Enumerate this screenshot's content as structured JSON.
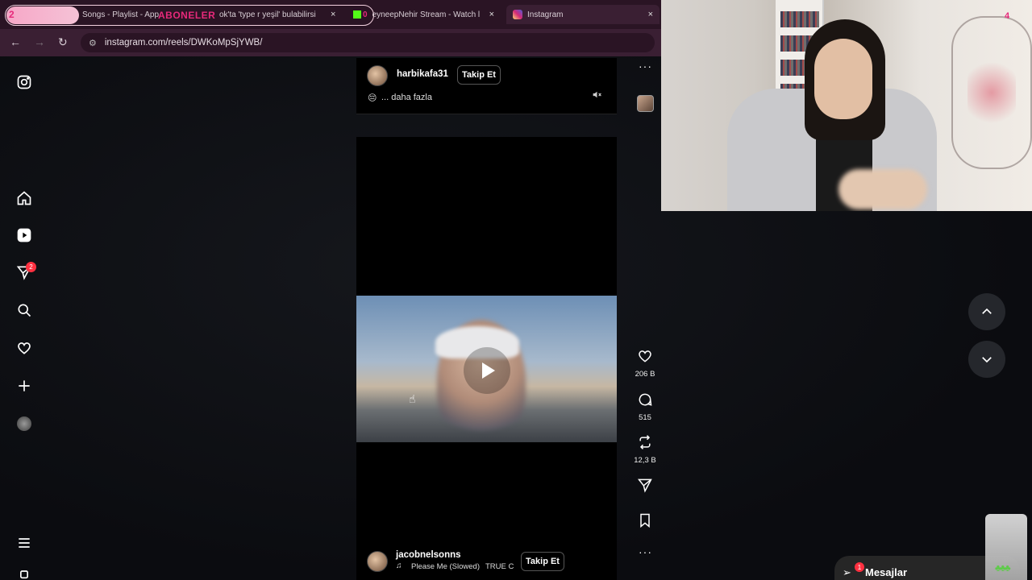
{
  "browser": {
    "overlay": {
      "counter": "2",
      "label": "ABONELER"
    },
    "tabs": [
      {
        "title": "Songs - Playlist - App",
        "close": "×"
      },
      {
        "title": "ok'ta 'type r yeşil' bulabilirsi",
        "close": "×"
      },
      {
        "title": "eyneepNehir Stream - Watch l",
        "prefix": "0",
        "close": "×"
      },
      {
        "title": "Instagram",
        "close": "×"
      }
    ],
    "url": "instagram.com/reels/DWKoMpSjYWB/"
  },
  "post_top": {
    "username": "harbikafa31",
    "follow_label": "Takip Et",
    "caption_emoji": "😔",
    "caption_more": "... daha fazla"
  },
  "post_bottom": {
    "username": "jacobnelsonns",
    "follow_label": "Takip Et",
    "music": "Please Me (Slowed)",
    "music_artist": "TRUE C"
  },
  "actions": {
    "likes": "206 B",
    "comments": "515",
    "reposts": "12,3 B"
  },
  "sidebar": {
    "messages_badge": "2"
  },
  "messages": {
    "label": "Mesajlar",
    "badge": "1"
  },
  "webcam": {
    "corner_num": "4"
  },
  "icons": [
    "instagram-icon",
    "home-icon",
    "reels-icon",
    "direct-icon",
    "search-icon",
    "heart-icon",
    "plus-icon",
    "menu-icon",
    "chevron-up-icon",
    "chevron-down-icon",
    "comment-icon",
    "repost-icon",
    "share-icon",
    "bookmark-icon",
    "mute-icon",
    "play-icon"
  ],
  "colors": {
    "overlay_pink": "#e6297a",
    "badge_red": "#ff3040",
    "tab_bg": "#2a1424"
  }
}
